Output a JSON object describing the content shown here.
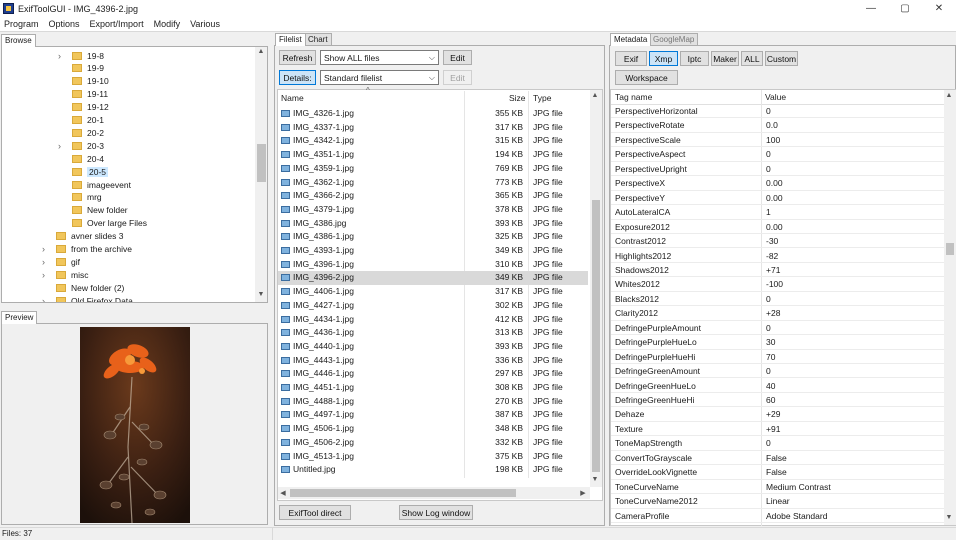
{
  "window": {
    "title": "ExifToolGUI - IMG_4396-2.jpg",
    "minimize": "—",
    "maximize": "▢",
    "close": "✕"
  },
  "menu": [
    "Program",
    "Options",
    "Export/Import",
    "Modify",
    "Various"
  ],
  "browse": {
    "tab": "Browse",
    "tree": [
      {
        "label": "19-8",
        "level": 2,
        "expander": true
      },
      {
        "label": "19-9",
        "level": 2,
        "expander": false
      },
      {
        "label": "19-10",
        "level": 2,
        "expander": false
      },
      {
        "label": "19-11",
        "level": 2,
        "expander": false
      },
      {
        "label": "19-12",
        "level": 2,
        "expander": false
      },
      {
        "label": "20-1",
        "level": 2,
        "expander": false
      },
      {
        "label": "20-2",
        "level": 2,
        "expander": false
      },
      {
        "label": "20-3",
        "level": 2,
        "expander": true
      },
      {
        "label": "20-4",
        "level": 2,
        "expander": false
      },
      {
        "label": "20-5",
        "level": 2,
        "expander": false,
        "selected": true
      },
      {
        "label": "imageevent",
        "level": 2,
        "expander": false
      },
      {
        "label": "mrg",
        "level": 2,
        "expander": false
      },
      {
        "label": "New folder",
        "level": 2,
        "expander": false
      },
      {
        "label": "Over large Files",
        "level": 2,
        "expander": false
      },
      {
        "label": "avner slides 3",
        "level": 1,
        "expander": false
      },
      {
        "label": "from the archive",
        "level": 1,
        "expander": true
      },
      {
        "label": "gif",
        "level": 1,
        "expander": true
      },
      {
        "label": "misc",
        "level": 1,
        "expander": true
      },
      {
        "label": "New folder (2)",
        "level": 1,
        "expander": false
      },
      {
        "label": "Old Firefox Data",
        "level": 1,
        "expander": true
      }
    ]
  },
  "preview": {
    "tab": "Preview"
  },
  "filelist": {
    "tabs": [
      "Filelist",
      "Chart"
    ],
    "refresh": "Refresh",
    "filter_value": "Show ALL files",
    "edit": "Edit",
    "details": "Details:",
    "view_value": "Standard filelist",
    "edit2": "Edit",
    "columns": [
      "Name",
      "Size",
      "Type"
    ],
    "files": [
      {
        "name": "IMG_4326-1.jpg",
        "size": "355 KB",
        "type": "JPG file"
      },
      {
        "name": "IMG_4337-1.jpg",
        "size": "317 KB",
        "type": "JPG file"
      },
      {
        "name": "IMG_4342-1.jpg",
        "size": "315 KB",
        "type": "JPG file"
      },
      {
        "name": "IMG_4351-1.jpg",
        "size": "194 KB",
        "type": "JPG file"
      },
      {
        "name": "IMG_4359-1.jpg",
        "size": "769 KB",
        "type": "JPG file"
      },
      {
        "name": "IMG_4362-1.jpg",
        "size": "773 KB",
        "type": "JPG file"
      },
      {
        "name": "IMG_4366-2.jpg",
        "size": "365 KB",
        "type": "JPG file"
      },
      {
        "name": "IMG_4379-1.jpg",
        "size": "378 KB",
        "type": "JPG file"
      },
      {
        "name": "IMG_4386.jpg",
        "size": "393 KB",
        "type": "JPG file"
      },
      {
        "name": "IMG_4386-1.jpg",
        "size": "325 KB",
        "type": "JPG file"
      },
      {
        "name": "IMG_4393-1.jpg",
        "size": "349 KB",
        "type": "JPG file"
      },
      {
        "name": "IMG_4396-1.jpg",
        "size": "310 KB",
        "type": "JPG file"
      },
      {
        "name": "IMG_4396-2.jpg",
        "size": "349 KB",
        "type": "JPG file",
        "selected": true
      },
      {
        "name": "IMG_4406-1.jpg",
        "size": "317 KB",
        "type": "JPG file"
      },
      {
        "name": "IMG_4427-1.jpg",
        "size": "302 KB",
        "type": "JPG file"
      },
      {
        "name": "IMG_4434-1.jpg",
        "size": "412 KB",
        "type": "JPG file"
      },
      {
        "name": "IMG_4436-1.jpg",
        "size": "313 KB",
        "type": "JPG file"
      },
      {
        "name": "IMG_4440-1.jpg",
        "size": "393 KB",
        "type": "JPG file"
      },
      {
        "name": "IMG_4443-1.jpg",
        "size": "336 KB",
        "type": "JPG file"
      },
      {
        "name": "IMG_4446-1.jpg",
        "size": "297 KB",
        "type": "JPG file"
      },
      {
        "name": "IMG_4451-1.jpg",
        "size": "308 KB",
        "type": "JPG file"
      },
      {
        "name": "IMG_4488-1.jpg",
        "size": "270 KB",
        "type": "JPG file"
      },
      {
        "name": "IMG_4497-1.jpg",
        "size": "387 KB",
        "type": "JPG file"
      },
      {
        "name": "IMG_4506-1.jpg",
        "size": "348 KB",
        "type": "JPG file"
      },
      {
        "name": "IMG_4506-2.jpg",
        "size": "332 KB",
        "type": "JPG file"
      },
      {
        "name": "IMG_4513-1.jpg",
        "size": "375 KB",
        "type": "JPG file"
      },
      {
        "name": "Untitled.jpg",
        "size": "198 KB",
        "type": "JPG file"
      }
    ],
    "exiftool_direct": "ExifTool direct",
    "show_log": "Show Log window"
  },
  "metadata": {
    "tabs": [
      "Metadata",
      "GoogleMap"
    ],
    "buttons": [
      "Exif",
      "Xmp",
      "Iptc",
      "Maker",
      "ALL",
      "Custom"
    ],
    "active_button": "Xmp",
    "workspace": "Workspace",
    "columns": [
      "Tag name",
      "Value"
    ],
    "rows": [
      {
        "tag": "PerspectiveHorizontal",
        "value": "0"
      },
      {
        "tag": "PerspectiveRotate",
        "value": "0.0"
      },
      {
        "tag": "PerspectiveScale",
        "value": "100"
      },
      {
        "tag": "PerspectiveAspect",
        "value": "0"
      },
      {
        "tag": "PerspectiveUpright",
        "value": "0"
      },
      {
        "tag": "PerspectiveX",
        "value": "0.00"
      },
      {
        "tag": "PerspectiveY",
        "value": "0.00"
      },
      {
        "tag": "AutoLateralCA",
        "value": "1"
      },
      {
        "tag": "Exposure2012",
        "value": "0.00"
      },
      {
        "tag": "Contrast2012",
        "value": "-30"
      },
      {
        "tag": "Highlights2012",
        "value": "-82"
      },
      {
        "tag": "Shadows2012",
        "value": "+71"
      },
      {
        "tag": "Whites2012",
        "value": "-100"
      },
      {
        "tag": "Blacks2012",
        "value": "0"
      },
      {
        "tag": "Clarity2012",
        "value": "+28"
      },
      {
        "tag": "DefringePurpleAmount",
        "value": "0"
      },
      {
        "tag": "DefringePurpleHueLo",
        "value": "30"
      },
      {
        "tag": "DefringePurpleHueHi",
        "value": "70"
      },
      {
        "tag": "DefringeGreenAmount",
        "value": "0"
      },
      {
        "tag": "DefringeGreenHueLo",
        "value": "40"
      },
      {
        "tag": "DefringeGreenHueHi",
        "value": "60"
      },
      {
        "tag": "Dehaze",
        "value": "+29"
      },
      {
        "tag": "Texture",
        "value": "+91"
      },
      {
        "tag": "ToneMapStrength",
        "value": "0"
      },
      {
        "tag": "ConvertToGrayscale",
        "value": "False"
      },
      {
        "tag": "OverrideLookVignette",
        "value": "False"
      },
      {
        "tag": "ToneCurveName",
        "value": "Medium Contrast"
      },
      {
        "tag": "ToneCurveName2012",
        "value": "Linear"
      },
      {
        "tag": "CameraProfile",
        "value": "Adobe Standard"
      }
    ]
  },
  "status": {
    "files": "Files: 37"
  },
  "colors": {
    "selection": "#cce8ff",
    "folder": "#f1c65b",
    "accent": "#0078d7"
  }
}
